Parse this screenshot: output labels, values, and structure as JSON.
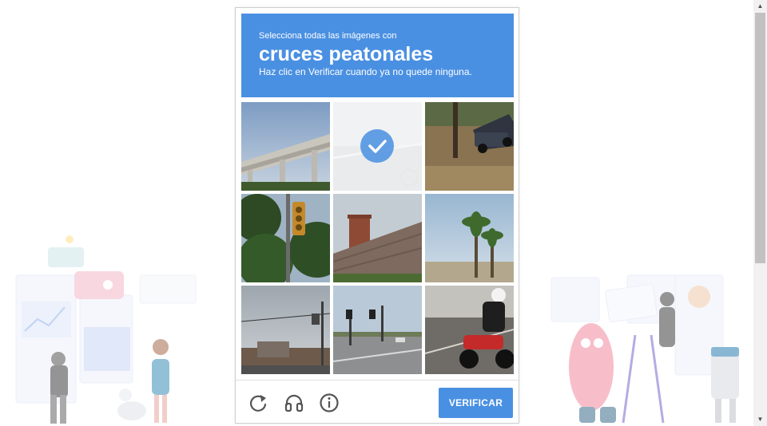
{
  "challenge": {
    "instruction_line1": "Selecciona todas las imágenes con",
    "target": "cruces peatonales",
    "instruction_line2": "Haz clic en Verificar cuando ya no quede ninguna."
  },
  "tiles": [
    {
      "content": "highway-overpass",
      "selected": false
    },
    {
      "content": "faded-road",
      "selected": true
    },
    {
      "content": "parked-car-leaves",
      "selected": false
    },
    {
      "content": "traffic-light-trees",
      "selected": false
    },
    {
      "content": "brick-chimney-roof",
      "selected": false
    },
    {
      "content": "palm-trees",
      "selected": false
    },
    {
      "content": "utility-poles-sky",
      "selected": false
    },
    {
      "content": "intersection-traffic-lights",
      "selected": false
    },
    {
      "content": "motorcycle-road",
      "selected": false
    }
  ],
  "footer": {
    "icons": [
      "reload-icon",
      "headphones-icon",
      "info-icon"
    ],
    "verify_label": "VERIFICAR"
  },
  "colors": {
    "accent": "#4a90e2"
  }
}
